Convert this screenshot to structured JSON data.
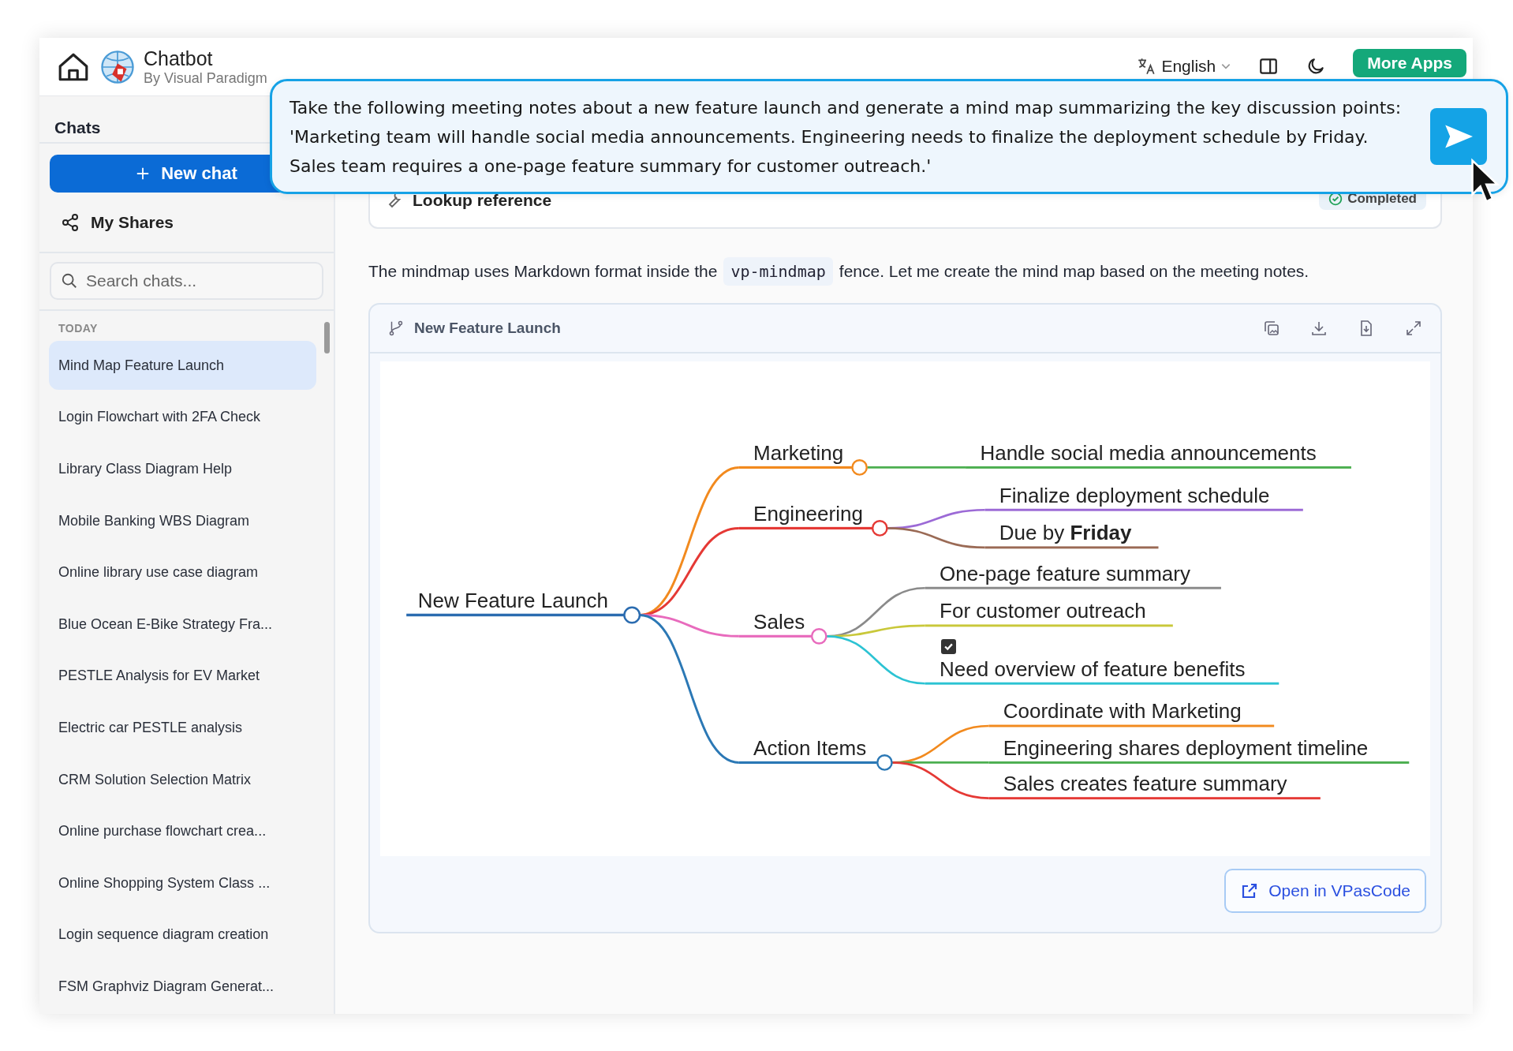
{
  "app": {
    "title": "Chatbot",
    "subtitle": "By Visual Paradigm"
  },
  "header": {
    "language": "English",
    "more_apps": "More Apps"
  },
  "sidebar": {
    "title": "Chats",
    "new_chat": "New chat",
    "my_shares": "My Shares",
    "search": {
      "placeholder": "Search chats..."
    },
    "section": "TODAY",
    "items": [
      {
        "label": "Mind Map Feature Launch",
        "selected": true
      },
      {
        "label": "Login Flowchart with 2FA Check",
        "selected": false
      },
      {
        "label": "Library Class Diagram Help",
        "selected": false
      },
      {
        "label": "Mobile Banking WBS Diagram",
        "selected": false
      },
      {
        "label": "Online library use case diagram",
        "selected": false
      },
      {
        "label": "Blue Ocean E-Bike Strategy Fra...",
        "selected": false
      },
      {
        "label": "PESTLE Analysis for EV Market",
        "selected": false
      },
      {
        "label": "Electric car PESTLE analysis",
        "selected": false
      },
      {
        "label": "CRM Solution Selection Matrix",
        "selected": false
      },
      {
        "label": "Online purchase flowchart crea...",
        "selected": false
      },
      {
        "label": "Online Shopping System Class ...",
        "selected": false
      },
      {
        "label": "Login sequence diagram creation",
        "selected": false
      },
      {
        "label": "FSM Graphviz Diagram Generat...",
        "selected": false
      }
    ]
  },
  "prompt": {
    "lines": [
      "Take the following meeting notes about a new feature launch and generate a mind map summarizing the key discussion points:",
      "'Marketing team will handle social media announcements. Engineering needs to finalize the deployment schedule by Friday.",
      "Sales team requires a one-page feature summary for customer outreach.'"
    ]
  },
  "tool_call": {
    "label": "Lookup reference",
    "status": "Completed"
  },
  "message": {
    "before": "The mindmap uses Markdown format inside the",
    "code": "vp-mindmap",
    "after": "fence. Let me create the mind map based on the meeting notes."
  },
  "mindmap": {
    "title": "New Feature Launch",
    "root": {
      "text": "New Feature Launch",
      "color": "#2b6cb0",
      "children": [
        {
          "text": "Marketing",
          "color": "#f28a1e",
          "children": [
            {
              "text": "Handle social media announcements",
              "color": "#4caf50",
              "kind": "text"
            }
          ]
        },
        {
          "text": "Engineering",
          "color": "#e53935",
          "children": [
            {
              "text": "Finalize deployment schedule",
              "color": "#9c6ad6",
              "kind": "text"
            },
            {
              "text": "Due by **Friday**",
              "color": "#9a6a55",
              "kind": "text"
            }
          ]
        },
        {
          "text": "Sales",
          "color": "#e86bbd",
          "children": [
            {
              "text": "One-page feature summary",
              "color": "#8a8a8a",
              "kind": "text"
            },
            {
              "text": "For customer outreach",
              "color": "#c9c83a",
              "kind": "text"
            },
            {
              "text": "Need overview of feature benefits",
              "color": "#2cc3d3",
              "kind": "task",
              "checked": true
            }
          ]
        },
        {
          "text": "Action Items",
          "color": "#2b78b5",
          "children": [
            {
              "text": "Coordinate with Marketing",
              "color": "#f28a1e",
              "kind": "text"
            },
            {
              "text": "Engineering shares deployment timeline",
              "color": "#4caf50",
              "kind": "text"
            },
            {
              "text": "Sales creates feature summary",
              "color": "#e53935",
              "kind": "text"
            }
          ]
        }
      ]
    }
  },
  "open_button": "Open in VPasCode"
}
